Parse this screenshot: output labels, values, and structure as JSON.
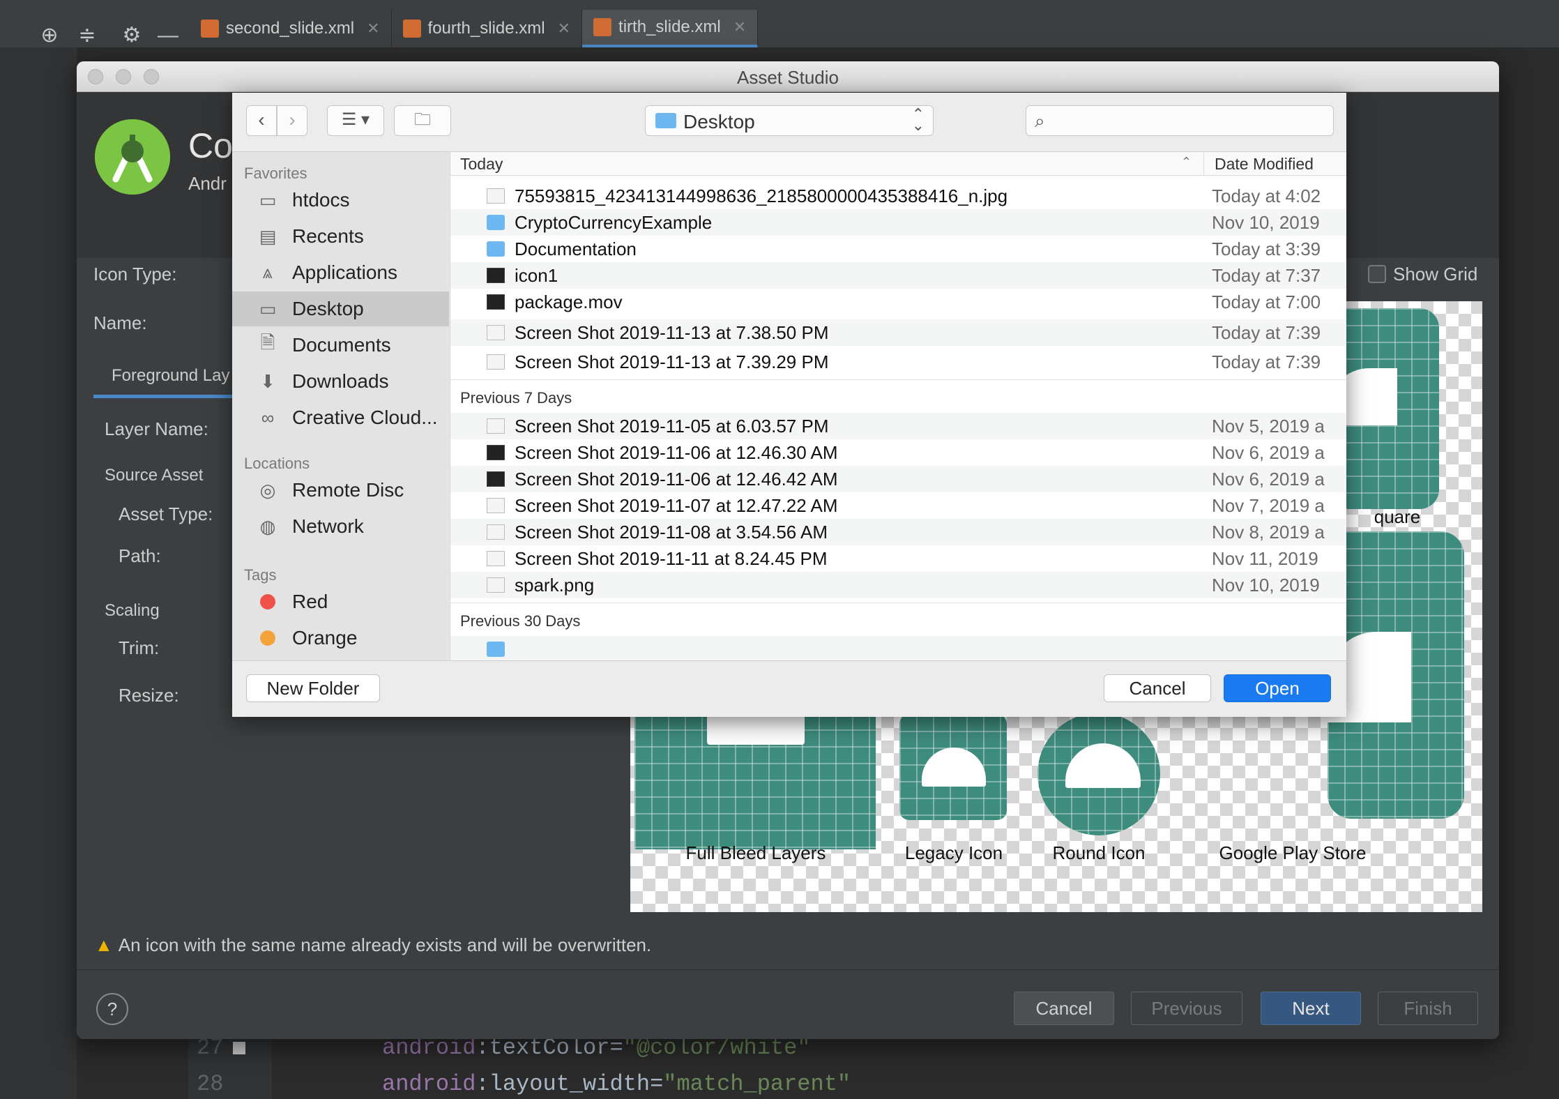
{
  "ide": {
    "tabs": [
      {
        "label": "second_slide.xml"
      },
      {
        "label": "fourth_slide.xml"
      },
      {
        "label": "tirth_slide.xml",
        "selected": true
      }
    ],
    "icons": [
      "crosshair-icon",
      "collapse-icon",
      "gear-icon",
      "minimize-icon"
    ],
    "code_lines": [
      {
        "num": "27",
        "attr": "android",
        "prop": ":textColor=",
        "value": "\"@color/white\""
      },
      {
        "num": "28",
        "attr": "android",
        "prop": ":layout_width=",
        "value": "\"match_parent\""
      }
    ]
  },
  "asset_studio": {
    "title": "Asset Studio",
    "header_title": "Co",
    "header_subtitle": "Andr",
    "icon_type_label": "Icon Type:",
    "name_label": "Name:",
    "foreground_tab": "Foreground Lay",
    "layer_name_label": "Layer Name:",
    "source_asset_label": "Source Asset",
    "asset_type_label": "Asset Type:",
    "path_label": "Path:",
    "scaling_label": "Scaling",
    "trim_label": "Trim:",
    "resize_label": "Resize:",
    "show_grid_label": "Show Grid",
    "preview_labels": {
      "square_partial": "quare",
      "full_bleed": "Full Bleed Layers",
      "legacy": "Legacy Icon",
      "round": "Round Icon",
      "play_store": "Google Play Store"
    },
    "warning": "An icon with the same name already exists and will be overwritten.",
    "buttons": {
      "cancel": "Cancel",
      "previous": "Previous",
      "next": "Next",
      "finish": "Finish"
    },
    "help": "?"
  },
  "file_dialog": {
    "location": "Desktop",
    "search_placeholder": "",
    "sidebar": {
      "favorites_header": "Favorites",
      "favorites": [
        {
          "label": "htdocs",
          "icon": "folder-icon"
        },
        {
          "label": "Recents",
          "icon": "recents-icon"
        },
        {
          "label": "Applications",
          "icon": "applications-icon"
        },
        {
          "label": "Desktop",
          "icon": "desktop-icon",
          "selected": true
        },
        {
          "label": "Documents",
          "icon": "documents-icon"
        },
        {
          "label": "Downloads",
          "icon": "downloads-icon"
        },
        {
          "label": "Creative Cloud...",
          "icon": "creative-cloud-icon"
        }
      ],
      "locations_header": "Locations",
      "locations": [
        {
          "label": "Remote Disc",
          "icon": "disc-icon"
        },
        {
          "label": "Network",
          "icon": "network-icon"
        }
      ],
      "tags_header": "Tags",
      "tags": [
        {
          "label": "Red",
          "color": "#f0524b"
        },
        {
          "label": "Orange",
          "color": "#f4a33a"
        }
      ]
    },
    "columns": {
      "name": "Today",
      "date": "Date Modified"
    },
    "groups": [
      {
        "label": "",
        "files": [
          {
            "name": "75593815_423413144998636_2185800000435388416_n.jpg",
            "date": "Today at 4:02",
            "kind": "file"
          },
          {
            "name": "CryptoCurrencyExample",
            "date": "Nov 10, 2019",
            "kind": "folder"
          },
          {
            "name": "Documentation",
            "date": "Today at 3:39",
            "kind": "folder"
          },
          {
            "name": "icon1",
            "date": "Today at 7:37",
            "kind": "dark"
          },
          {
            "name": "package.mov",
            "date": "Today at 7:00",
            "kind": "dark"
          },
          {
            "name": "Screen Shot 2019-11-13 at 7.38.50 PM",
            "date": "Today at 7:39",
            "kind": "file"
          },
          {
            "name": "Screen Shot 2019-11-13 at 7.39.29 PM",
            "date": "Today at 7:39",
            "kind": "file"
          }
        ]
      },
      {
        "label": "Previous 7 Days",
        "files": [
          {
            "name": "Screen Shot 2019-11-05 at 6.03.57 PM",
            "date": "Nov 5, 2019 a",
            "kind": "file"
          },
          {
            "name": "Screen Shot 2019-11-06 at 12.46.30 AM",
            "date": "Nov 6, 2019 a",
            "kind": "dark"
          },
          {
            "name": "Screen Shot 2019-11-06 at 12.46.42 AM",
            "date": "Nov 6, 2019 a",
            "kind": "dark"
          },
          {
            "name": "Screen Shot 2019-11-07 at 12.47.22 AM",
            "date": "Nov 7, 2019 a",
            "kind": "file"
          },
          {
            "name": "Screen Shot 2019-11-08 at 3.54.56 AM",
            "date": "Nov 8, 2019 a",
            "kind": "file"
          },
          {
            "name": "Screen Shot 2019-11-11 at 8.24.45 PM",
            "date": "Nov 11, 2019",
            "kind": "file"
          },
          {
            "name": "spark.png",
            "date": "Nov 10, 2019",
            "kind": "file"
          }
        ]
      },
      {
        "label": "Previous 30 Days",
        "files": []
      }
    ],
    "buttons": {
      "new_folder": "New Folder",
      "cancel": "Cancel",
      "open": "Open"
    }
  }
}
